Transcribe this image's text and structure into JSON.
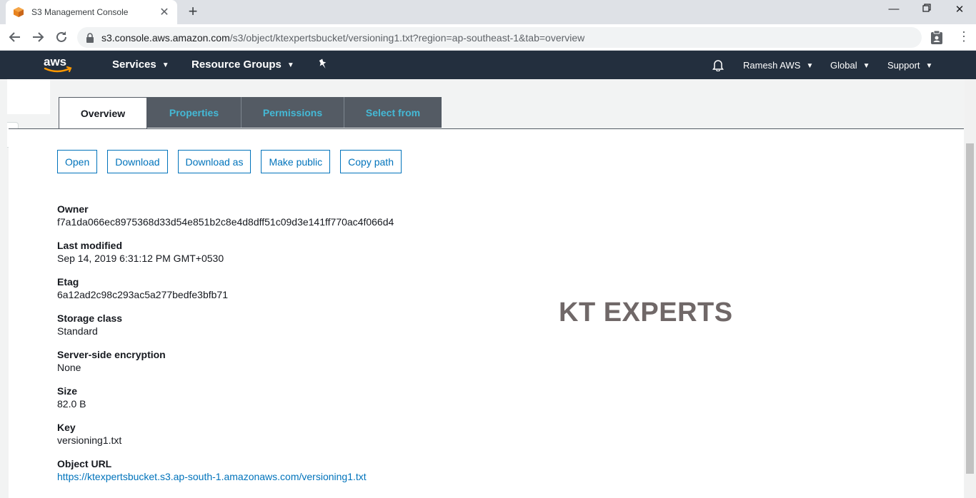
{
  "browser": {
    "tab_title": "S3 Management Console",
    "url_host": "s3.console.aws.amazon.com",
    "url_path": "/s3/object/ktexpertsbucket/versioning1.txt?region=ap-southeast-1&tab=overview"
  },
  "aws_nav": {
    "logo_text": "aws",
    "services": "Services",
    "resource_groups": "Resource Groups",
    "user": "Ramesh AWS",
    "region": "Global",
    "support": "Support"
  },
  "tabs": [
    {
      "label": "Overview",
      "active": true
    },
    {
      "label": "Properties",
      "active": false
    },
    {
      "label": "Permissions",
      "active": false
    },
    {
      "label": "Select from",
      "active": false
    }
  ],
  "actions": {
    "open": "Open",
    "download": "Download",
    "download_as": "Download as",
    "make_public": "Make public",
    "copy_path": "Copy path"
  },
  "details": {
    "owner_label": "Owner",
    "owner_value": "f7a1da066ec8975368d33d54e851b2c8e4d8dff51c09d3e141ff770ac4f066d4",
    "last_modified_label": "Last modified",
    "last_modified_value": "Sep 14, 2019 6:31:12 PM GMT+0530",
    "etag_label": "Etag",
    "etag_value": "6a12ad2c98c293ac5a277bedfe3bfb71",
    "storage_class_label": "Storage class",
    "storage_class_value": "Standard",
    "encryption_label": "Server-side encryption",
    "encryption_value": "None",
    "size_label": "Size",
    "size_value": "82.0 B",
    "key_label": "Key",
    "key_value": "versioning1.txt",
    "object_url_label": "Object URL",
    "object_url_value": "https://ktexpertsbucket.s3.ap-south-1.amazonaws.com/versioning1.txt"
  },
  "watermark": "KT EXPERTS"
}
